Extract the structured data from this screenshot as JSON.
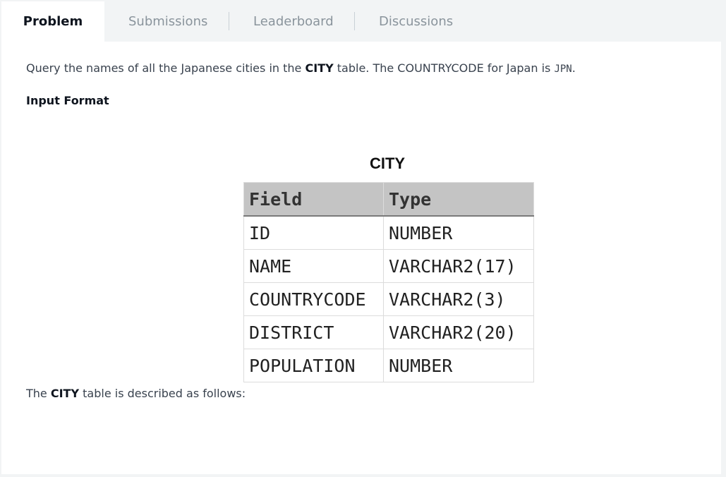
{
  "tabs": [
    {
      "label": "Problem",
      "active": true
    },
    {
      "label": "Submissions",
      "active": false
    },
    {
      "label": "Leaderboard",
      "active": false
    },
    {
      "label": "Discussions",
      "active": false
    }
  ],
  "problem": {
    "intro_prefix": "Query the names of all the Japanese cities in the ",
    "intro_table": "CITY",
    "intro_middle": " table. The COUNTRYCODE for Japan is ",
    "intro_code": "JPN",
    "intro_suffix": ".",
    "input_format_heading": "Input Format",
    "footer_table": "CITY",
    "footer_prefix": "The ",
    "footer_suffix": " table is described as follows:"
  },
  "schema": {
    "title": "CITY",
    "headers": [
      "Field",
      "Type"
    ],
    "rows": [
      [
        "ID",
        "NUMBER"
      ],
      [
        "NAME",
        "VARCHAR2(17)"
      ],
      [
        "COUNTRYCODE",
        "VARCHAR2(3)"
      ],
      [
        "DISTRICT",
        "VARCHAR2(20)"
      ],
      [
        "POPULATION",
        "NUMBER"
      ]
    ]
  },
  "colors": {
    "active_tab_text": "#0e141e",
    "inactive_tab_text": "#8a949c",
    "body_text": "#39424e",
    "table_header_bg": "#c4c4c4"
  }
}
